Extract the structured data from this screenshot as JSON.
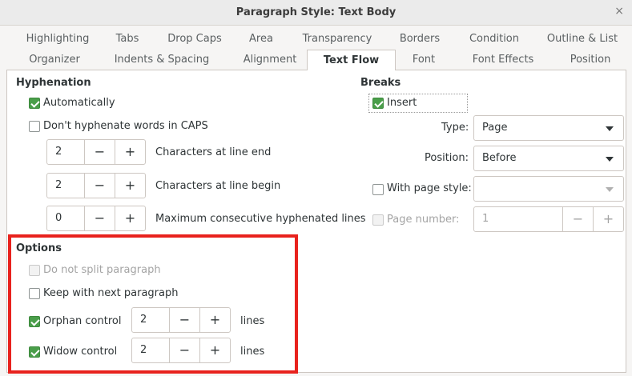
{
  "window": {
    "title": "Paragraph Style: Text Body",
    "close_glyph": "×"
  },
  "tabs_row1": [
    "Highlighting",
    "Tabs",
    "Drop Caps",
    "Area",
    "Transparency",
    "Borders",
    "Condition",
    "Outline & List"
  ],
  "tabs_row2": [
    "Organizer",
    "Indents & Spacing",
    "Alignment",
    "Text Flow",
    "Font",
    "Font Effects",
    "Position"
  ],
  "active_tab": "Text Flow",
  "hyphenation": {
    "heading": "Hyphenation",
    "automatically": {
      "label": "Automatically",
      "checked": true
    },
    "dont_caps": {
      "label": "Don't hyphenate words in CAPS",
      "checked": false
    },
    "chars_line_end": {
      "value": "2",
      "label": "Characters at line end"
    },
    "chars_line_begin": {
      "value": "2",
      "label": "Characters at line begin"
    },
    "max_consecutive": {
      "value": "0",
      "label": "Maximum consecutive hyphenated lines"
    }
  },
  "breaks": {
    "heading": "Breaks",
    "insert": {
      "label": "Insert",
      "checked": true
    },
    "type": {
      "label": "Type:",
      "value": "Page"
    },
    "position": {
      "label": "Position:",
      "value": "Before"
    },
    "with_page_style": {
      "label": "With page style:",
      "checked": false,
      "value": ""
    },
    "page_number": {
      "label": "Page number:",
      "checked": false,
      "value": "1"
    }
  },
  "options": {
    "heading": "Options",
    "do_not_split": {
      "label": "Do not split paragraph",
      "checked": false
    },
    "keep_with_next": {
      "label": "Keep with next paragraph",
      "checked": false
    },
    "orphan": {
      "label": "Orphan control",
      "checked": true,
      "value": "2",
      "unit": "lines"
    },
    "widow": {
      "label": "Widow control",
      "checked": true,
      "value": "2",
      "unit": "lines"
    }
  },
  "spin_glyphs": {
    "minus": "−",
    "plus": "+"
  },
  "colors": {
    "accent_check": "#4a9e4a",
    "highlight_box": "#e8221d"
  }
}
